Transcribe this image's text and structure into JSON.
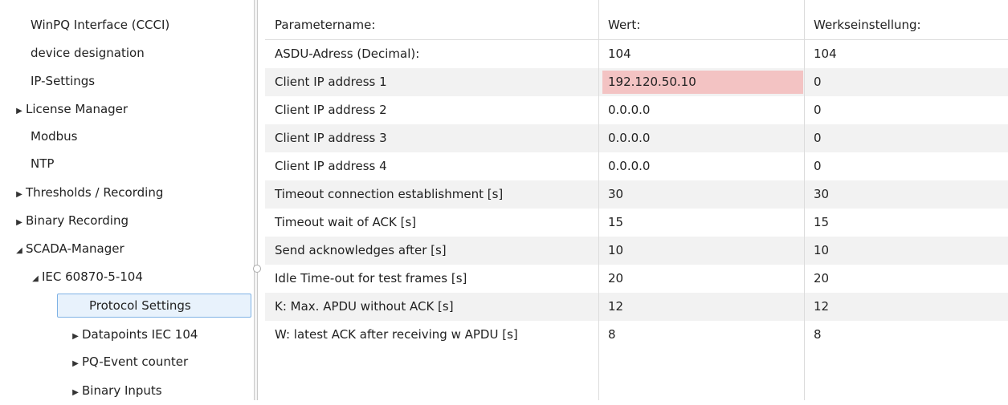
{
  "tree": {
    "items": [
      {
        "label": "WinPQ Interface (CCCI)",
        "arrow": ""
      },
      {
        "label": "device designation",
        "arrow": ""
      },
      {
        "label": "IP-Settings",
        "arrow": ""
      },
      {
        "label": "License Manager",
        "arrow": "▶"
      },
      {
        "label": "Modbus",
        "arrow": ""
      },
      {
        "label": "NTP",
        "arrow": ""
      },
      {
        "label": "Thresholds / Recording",
        "arrow": "▶"
      },
      {
        "label": "Binary Recording",
        "arrow": "▶"
      },
      {
        "label": "SCADA-Manager",
        "arrow": "◢"
      },
      {
        "label": "IEC 60870-5-104",
        "arrow": "◢"
      },
      {
        "label": "Protocol Settings",
        "arrow": ""
      },
      {
        "label": "Datapoints IEC 104",
        "arrow": "▶"
      },
      {
        "label": "PQ-Event counter",
        "arrow": "▶"
      },
      {
        "label": "Binary Inputs",
        "arrow": "▶"
      }
    ]
  },
  "grid": {
    "headers": [
      "Parametername:",
      "Wert:",
      "Werkseinstellung:"
    ],
    "rows": [
      [
        "ASDU-Adress (Decimal):",
        "104",
        "104"
      ],
      [
        "Client IP address 1",
        "192.120.50.10",
        "0"
      ],
      [
        "Client IP address 2",
        "0.0.0.0",
        "0"
      ],
      [
        "Client IP address 3",
        "0.0.0.0",
        "0"
      ],
      [
        "Client IP address 4",
        "0.0.0.0",
        "0"
      ],
      [
        "Timeout connection establishment [s]",
        "30",
        "30"
      ],
      [
        "Timeout wait of ACK [s]",
        "15",
        "15"
      ],
      [
        "Send acknowledges after [s]",
        "10",
        "10"
      ],
      [
        "Idle Time-out for test frames [s]",
        "20",
        "20"
      ],
      [
        "K: Max. APDU without ACK [s]",
        "12",
        "12"
      ],
      [
        "W: latest ACK after receiving w APDU [s]",
        "8",
        "8"
      ]
    ]
  },
  "colors": {
    "error_cell": "#f3c3c3",
    "selected": "#e8f2fc",
    "alt_row": "#f2f2f2"
  }
}
